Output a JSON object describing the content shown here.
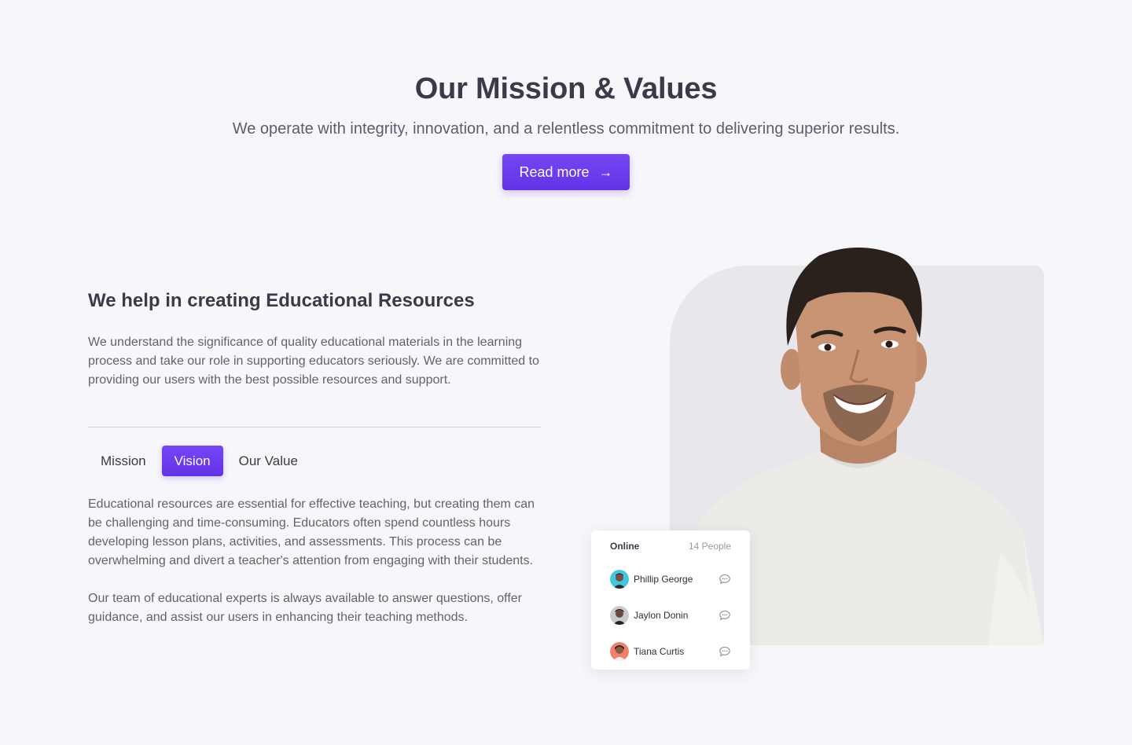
{
  "hero": {
    "title": "Our Mission & Values",
    "subtitle": "We operate with integrity, innovation, and a relentless commitment to delivering superior results.",
    "button_label": "Read more",
    "button_icon": "arrow-right-icon"
  },
  "section": {
    "title": "We help in creating Educational Resources",
    "intro": "We understand the significance of quality educational materials in the learning process and take our role in supporting educators seriously. We are committed to providing our users with the best possible resources and support."
  },
  "tabs": [
    {
      "label": "Mission",
      "active": false
    },
    {
      "label": "Vision",
      "active": true
    },
    {
      "label": "Our Value",
      "active": false
    }
  ],
  "tab_content": {
    "paragraph_1": "Educational resources are essential for effective teaching, but creating them can be challenging and time-consuming. Educators often spend countless hours developing lesson plans, activities, and assessments. This process can be overwhelming and divert a teacher's attention from engaging with their students.",
    "paragraph_2": "Our team of educational experts is always available to answer questions, offer guidance, and assist our users in enhancing their teaching methods."
  },
  "online": {
    "label": "Online",
    "count": "14 People",
    "users": [
      {
        "name": "Phillip George",
        "avatar_color": "#3fc6e0"
      },
      {
        "name": "Jaylon Donin",
        "avatar_color": "#c9c9cf"
      },
      {
        "name": "Tiana Curtis",
        "avatar_color": "#f0806a"
      }
    ]
  },
  "colors": {
    "accent": "#6a3cf0",
    "background": "#f7f7fb",
    "photo_bg": "#e7e7ec"
  }
}
